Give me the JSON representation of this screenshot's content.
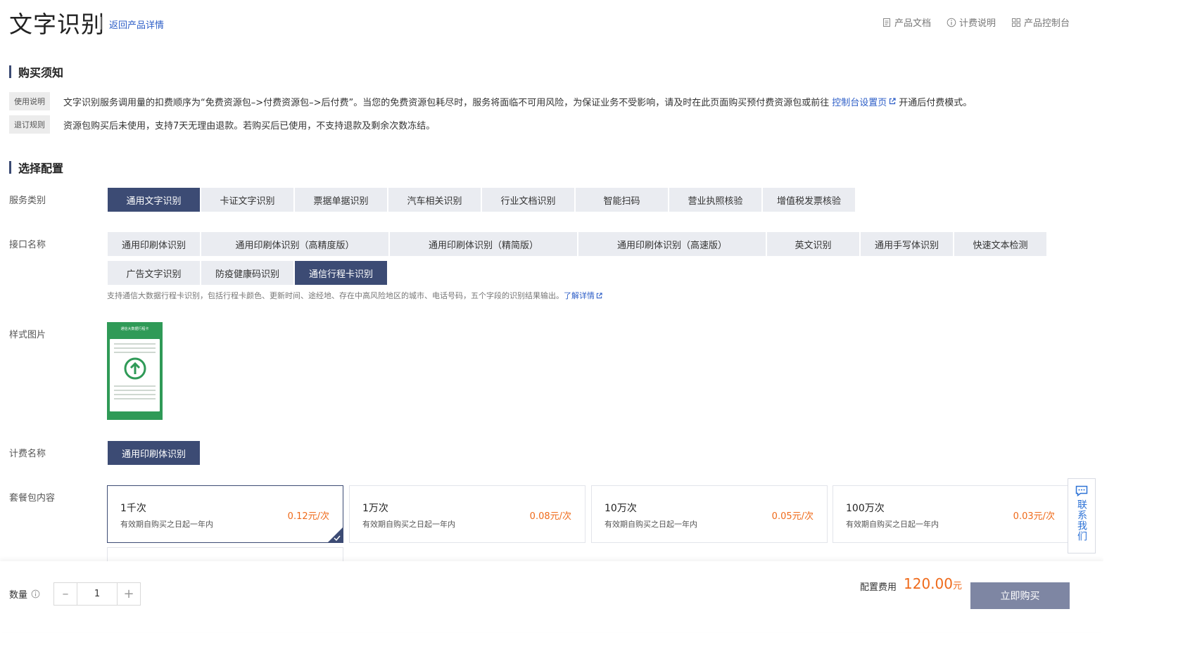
{
  "header": {
    "title": "文字识别",
    "back_link": "返回产品详情",
    "links": [
      {
        "label": "产品文档",
        "icon": "document-icon"
      },
      {
        "label": "计费说明",
        "icon": "info-icon"
      },
      {
        "label": "产品控制台",
        "icon": "grid-icon"
      }
    ]
  },
  "notice": {
    "title": "购买须知",
    "usage": {
      "tag": "使用说明",
      "text_before": "文字识别服务调用量的扣费顺序为“免费资源包–>付费资源包–>后付费”。当您的免费资源包耗尽时，服务将面临不可用风险，为保证业务不受影响，请及时在此页面购买预付费资源包或前往",
      "link": "控制台设置页",
      "text_after": "开通后付费模式。"
    },
    "refund": {
      "tag": "退订规则",
      "text": "资源包购买后未使用，支持7天无理由退款。若购买后已使用，不支持退款及剩余次数冻结。"
    }
  },
  "config": {
    "title": "选择配置",
    "service_label": "服务类别",
    "service_types": [
      "通用文字识别",
      "卡证文字识别",
      "票据单据识别",
      "汽车相关识别",
      "行业文档识别",
      "智能扫码",
      "营业执照核验",
      "增值税发票核验"
    ],
    "api_label": "接口名称",
    "apis_row1": [
      "通用印刷体识别",
      "通用印刷体识别（高精度版）",
      "通用印刷体识别（精简版）",
      "通用印刷体识别（高速版）",
      "英文识别",
      "通用手写体识别",
      "快速文本检测"
    ],
    "apis_row2": [
      "广告文字识别",
      "防疫健康码识别",
      "通信行程卡识别"
    ],
    "api_desc": "支持通信大数据行程卡识别，包括行程卡颜色、更新时间、途经地、存在中高风险地区的城市、电话号码，五个字段的识别结果输出。",
    "api_desc_link": "了解详情",
    "sample_label": "样式图片",
    "sample_header": "通信大数据行程卡",
    "billing_label": "计费名称",
    "billing_name": "通用印刷体识别",
    "package_label": "套餐包内容",
    "packages": [
      {
        "name": "1千次",
        "validity": "有效期自购买之日起一年内",
        "price": "0.12元/次"
      },
      {
        "name": "1万次",
        "validity": "有效期自购买之日起一年内",
        "price": "0.08元/次"
      },
      {
        "name": "10万次",
        "validity": "有效期自购买之日起一年内",
        "price": "0.05元/次"
      },
      {
        "name": "100万次",
        "validity": "有效期自购买之日起一年内",
        "price": "0.03元/次"
      }
    ]
  },
  "contact": {
    "label": "联系我们"
  },
  "footer": {
    "qty_label": "数量",
    "qty_value": "1",
    "minus": "–",
    "plus": "+",
    "cost_label": "配置费用",
    "cost_value": "120.00",
    "cost_unit": "元",
    "buy_label": "立即购买"
  },
  "colors": {
    "accent": "#3c4b74",
    "link": "#2d5ec7",
    "price": "#ef6a1a",
    "buy_button": "#7e86a3"
  }
}
